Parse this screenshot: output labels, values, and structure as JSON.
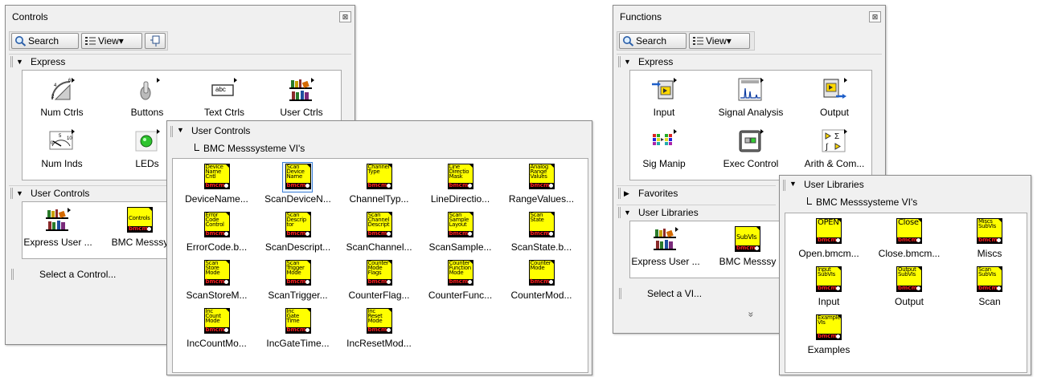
{
  "controls": {
    "title": "Controls",
    "close": "⊠",
    "toolbar": {
      "search": "Search",
      "view": "View▾"
    },
    "express": {
      "label": "Express",
      "items": [
        {
          "label": "Num Ctrls"
        },
        {
          "label": "Buttons"
        },
        {
          "label": "Text Ctrls"
        },
        {
          "label": "User Ctrls"
        },
        {
          "label": "Num Inds"
        },
        {
          "label": "LEDs"
        }
      ],
      "text_ctrl_icon_text": "abc"
    },
    "user_controls": {
      "label": "User Controls",
      "items": [
        {
          "label": "Express User ..."
        },
        {
          "label": "BMC Messsy",
          "icon_text": "Controls"
        }
      ]
    },
    "status": "Select a Control..."
  },
  "user_controls_popup": {
    "header": "User Controls",
    "subheader": "BMC Messsysteme VI's",
    "items": [
      {
        "label": "DeviceName...",
        "icon_text": "Device\nName\nCntl"
      },
      {
        "label": "ScanDeviceN...",
        "icon_text": "Scan\nDevice\nName"
      },
      {
        "label": "ChannelTyp...",
        "icon_text": "Channel\nType"
      },
      {
        "label": "LineDirectio...",
        "icon_text": "Line\nDirectio\nMask"
      },
      {
        "label": "RangeValues...",
        "icon_text": "Analog\nRange\nValues"
      },
      {
        "label": "ErrorCode.b...",
        "icon_text": "Error\nCode\nControl"
      },
      {
        "label": "ScanDescript...",
        "icon_text": "Scan\nDescrip\ntor"
      },
      {
        "label": "ScanChannel...",
        "icon_text": "Scan\nChannel\nDescript"
      },
      {
        "label": "ScanSample...",
        "icon_text": "Scan\nSample\nLayout"
      },
      {
        "label": "ScanState.b...",
        "icon_text": "Scan\nState"
      },
      {
        "label": "ScanStoreM...",
        "icon_text": "Scan\nStore\nMode"
      },
      {
        "label": "ScanTrigger...",
        "icon_text": "Scan\nTrigger\nMode"
      },
      {
        "label": "CounterFlag...",
        "icon_text": "Counter\nMode\nFlags"
      },
      {
        "label": "CounterFunc...",
        "icon_text": "Counter\nFunction\nMode"
      },
      {
        "label": "CounterMod...",
        "icon_text": "Counter\nMode"
      },
      {
        "label": "IncCountMo...",
        "icon_text": "Inc\nCount\nMode"
      },
      {
        "label": "IncGateTime...",
        "icon_text": "Inc\nGate\nTime"
      },
      {
        "label": "IncResetMod...",
        "icon_text": "Inc\nReset\nMode"
      }
    ],
    "brand": "bmcm"
  },
  "functions": {
    "title": "Functions",
    "close": "⊠",
    "toolbar": {
      "search": "Search",
      "view": "View▾"
    },
    "express": {
      "label": "Express",
      "items": [
        {
          "label": "Input"
        },
        {
          "label": "Signal Analysis"
        },
        {
          "label": "Output"
        },
        {
          "label": "Sig Manip"
        },
        {
          "label": "Exec Control"
        },
        {
          "label": "Arith & Com..."
        }
      ]
    },
    "favorites": {
      "label": "Favorites"
    },
    "user_libraries": {
      "label": "User Libraries",
      "items": [
        {
          "label": "Express User ..."
        },
        {
          "label": "BMC Messsy",
          "icon_text": "SubVIs"
        }
      ]
    },
    "status": "Select a VI...",
    "more": "»"
  },
  "user_libraries_popup": {
    "header": "User Libraries",
    "subheader": "BMC Messsysteme VI's",
    "items": [
      {
        "label": "Open.bmcm...",
        "icon_text": "OPEN"
      },
      {
        "label": "Close.bmcm...",
        "icon_text": "Close"
      },
      {
        "label": "Miscs",
        "icon_text": "Miscs\nSubVIs"
      },
      {
        "label": "Input",
        "icon_text": "Input\nSubVIs"
      },
      {
        "label": "Output",
        "icon_text": "Output\nSubVIs"
      },
      {
        "label": "Scan",
        "icon_text": "Scan\nSubVIs"
      },
      {
        "label": "Examples",
        "icon_text": "Example\nVIs"
      }
    ],
    "brand": "bmcm"
  }
}
